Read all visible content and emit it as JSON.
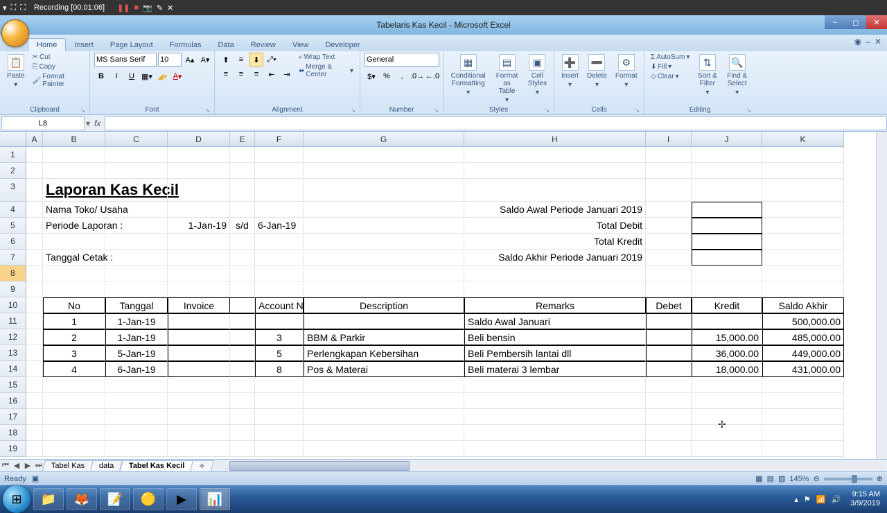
{
  "recorder": {
    "label": "Recording [00:01:06]"
  },
  "window": {
    "title": "Tabelaris Kas Kecil - Microsoft Excel"
  },
  "tabs": [
    "Home",
    "Insert",
    "Page Layout",
    "Formulas",
    "Data",
    "Review",
    "View",
    "Developer"
  ],
  "ribbon": {
    "clipboard": {
      "paste": "Paste",
      "cut": "Cut",
      "copy": "Copy",
      "format_painter": "Format Painter",
      "label": "Clipboard"
    },
    "font": {
      "name": "MS Sans Serif",
      "size": "10",
      "label": "Font"
    },
    "alignment": {
      "wrap": "Wrap Text",
      "merge": "Merge & Center",
      "label": "Alignment"
    },
    "number": {
      "format": "General",
      "label": "Number"
    },
    "styles": {
      "cond": "Conditional Formatting",
      "fat": "Format as Table",
      "cs": "Cell Styles",
      "label": "Styles"
    },
    "cells": {
      "insert": "Insert",
      "delete": "Delete",
      "format": "Format",
      "label": "Cells"
    },
    "editing": {
      "autosum": "AutoSum",
      "fill": "Fill",
      "clear": "Clear",
      "sort": "Sort & Filter",
      "find": "Find & Select",
      "label": "Editing"
    }
  },
  "namebox": "L8",
  "columns": [
    "A",
    "B",
    "C",
    "D",
    "E",
    "F",
    "G",
    "H",
    "I",
    "J",
    "K"
  ],
  "rows_shown": 19,
  "report": {
    "title": "Laporan Kas Kecil",
    "nama_label": "Nama Toko/ Usaha",
    "periode_label": "Periode Laporan :",
    "periode_from": "1-Jan-19",
    "sd": "s/d",
    "periode_to": "6-Jan-19",
    "cetak_label": "Tanggal Cetak :",
    "saldo_awal_label": "Saldo Awal Periode Januari 2019",
    "total_debit_label": "Total Debit",
    "total_kredit_label": "Total Kredit",
    "saldo_akhir_label": "Saldo Akhir Periode Januari 2019"
  },
  "table": {
    "headers": [
      "No",
      "Tanggal",
      "Invoice",
      "Account No.",
      "Description",
      "Remarks",
      "Debet",
      "Kredit",
      "Saldo Akhir"
    ],
    "rows": [
      {
        "no": "1",
        "tgl": "1-Jan-19",
        "inv": "",
        "acc": "",
        "desc": "",
        "rem": "Saldo Awal Januari",
        "deb": "",
        "kre": "",
        "saldo": "500,000.00"
      },
      {
        "no": "2",
        "tgl": "1-Jan-19",
        "inv": "",
        "acc": "3",
        "desc": "BBM & Parkir",
        "rem": "Beli bensin",
        "deb": "",
        "kre": "15,000.00",
        "saldo": "485,000.00"
      },
      {
        "no": "3",
        "tgl": "5-Jan-19",
        "inv": "",
        "acc": "5",
        "desc": "Perlengkapan Kebersihan",
        "rem": "Beli Pembersih lantai dll",
        "deb": "",
        "kre": "36,000.00",
        "saldo": "449,000.00"
      },
      {
        "no": "4",
        "tgl": "6-Jan-19",
        "inv": "",
        "acc": "8",
        "desc": "Pos & Materai",
        "rem": "Beli materai 3 lembar",
        "deb": "",
        "kre": "18,000.00",
        "saldo": "431,000.00"
      }
    ]
  },
  "sheets": [
    "Tabel Kas",
    "data",
    "Tabel Kas Kecil"
  ],
  "status": {
    "ready": "Ready",
    "zoom": "145%"
  },
  "clock": {
    "time": "9:15 AM",
    "date": "3/9/2019"
  }
}
